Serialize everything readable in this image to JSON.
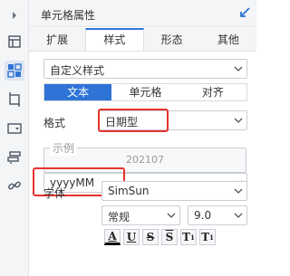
{
  "header": {
    "title": "单元格属性"
  },
  "tabs": [
    {
      "label": "扩展"
    },
    {
      "label": "样式"
    },
    {
      "label": "形态"
    },
    {
      "label": "其他"
    }
  ],
  "style_preset": {
    "value": "自定义样式"
  },
  "subtabs": [
    {
      "label": "文本"
    },
    {
      "label": "单元格"
    },
    {
      "label": "对齐"
    }
  ],
  "format": {
    "label": "格式",
    "value": "日期型"
  },
  "example": {
    "legend": "示例",
    "value": "202107"
  },
  "pattern": {
    "value": "yyyyMM"
  },
  "font": {
    "label": "字体",
    "family": "SimSun",
    "weight": "常规",
    "size": "9.0"
  },
  "format_buttons": [
    {
      "label": "A"
    },
    {
      "label": "U"
    },
    {
      "label": "S"
    },
    {
      "label": "S"
    },
    {
      "label": "T"
    },
    {
      "label": "T"
    }
  ],
  "colors": {
    "accent": "#2f73d6",
    "highlight": "#e8332c"
  }
}
